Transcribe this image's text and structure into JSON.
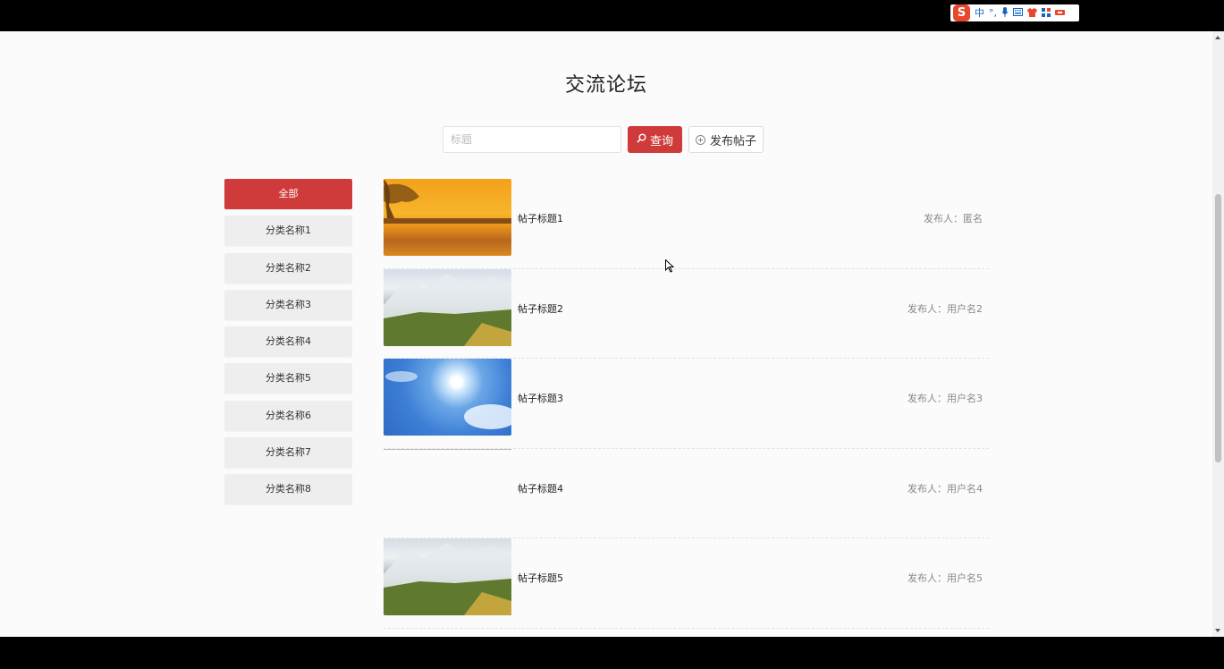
{
  "ime": {
    "logo": "S",
    "items": [
      "中",
      "°,",
      "🎤",
      "⌨",
      "👕",
      "▦",
      "✉"
    ]
  },
  "page": {
    "title": "交流论坛"
  },
  "search": {
    "placeholder": "标题",
    "value": "",
    "search_label": "查询",
    "post_label": "发布帖子"
  },
  "categories": [
    {
      "label": "全部",
      "active": true
    },
    {
      "label": "分类名称1",
      "active": false
    },
    {
      "label": "分类名称2",
      "active": false
    },
    {
      "label": "分类名称3",
      "active": false
    },
    {
      "label": "分类名称4",
      "active": false
    },
    {
      "label": "分类名称5",
      "active": false
    },
    {
      "label": "分类名称6",
      "active": false
    },
    {
      "label": "分类名称7",
      "active": false
    },
    {
      "label": "分类名称8",
      "active": false
    }
  ],
  "posts": [
    {
      "title": "帖子标题1",
      "author": "发布人：匿名",
      "image": "sunset"
    },
    {
      "title": "帖子标题2",
      "author": "发布人：用户名2",
      "image": "mountain"
    },
    {
      "title": "帖子标题3",
      "author": "发布人：用户名3",
      "image": "sky"
    },
    {
      "title": "帖子标题4",
      "author": "发布人：用户名4",
      "image": "blank"
    },
    {
      "title": "帖子标题5",
      "author": "发布人：用户名5",
      "image": "mountain"
    }
  ],
  "colors": {
    "accent": "#cf3b3b",
    "category_bg": "#eeeeee",
    "page_bg": "#fbfbfb"
  }
}
